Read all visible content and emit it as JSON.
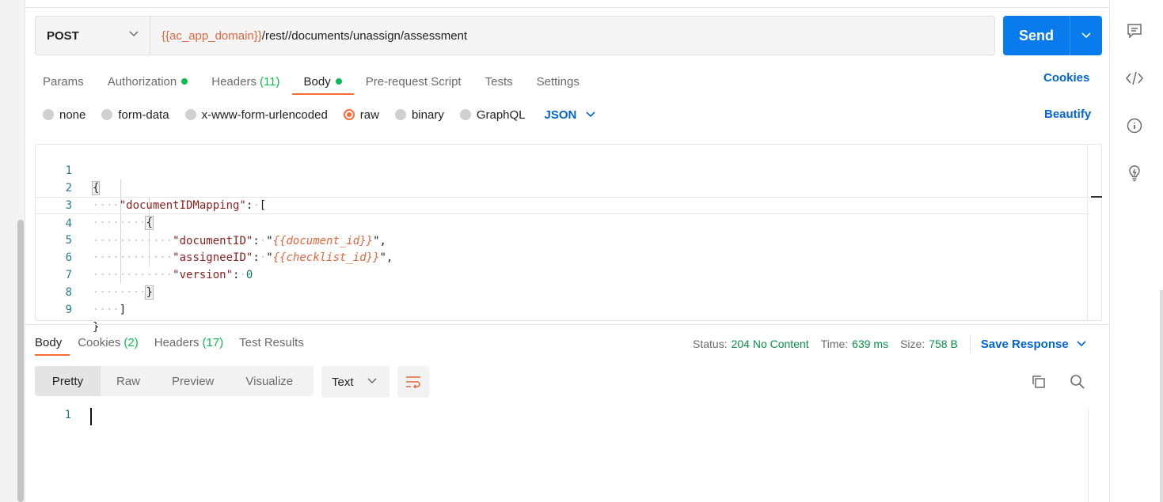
{
  "request": {
    "method": "POST",
    "url_variable": "{{ac_app_domain}}",
    "url_path": "/rest//documents/unassign/assessment",
    "send_label": "Send"
  },
  "request_tabs": [
    {
      "label": "Params",
      "count": "",
      "dot": false,
      "active": false
    },
    {
      "label": "Authorization",
      "count": "",
      "dot": true,
      "active": false
    },
    {
      "label": "Headers",
      "count": "(11)",
      "dot": false,
      "active": false
    },
    {
      "label": "Body",
      "count": "",
      "dot": true,
      "active": true
    },
    {
      "label": "Pre-request Script",
      "count": "",
      "dot": false,
      "active": false
    },
    {
      "label": "Tests",
      "count": "",
      "dot": false,
      "active": false
    },
    {
      "label": "Settings",
      "count": "",
      "dot": false,
      "active": false
    }
  ],
  "cookies_label": "Cookies",
  "body_types": [
    {
      "label": "none",
      "selected": false
    },
    {
      "label": "form-data",
      "selected": false
    },
    {
      "label": "x-www-form-urlencoded",
      "selected": false
    },
    {
      "label": "raw",
      "selected": true
    },
    {
      "label": "binary",
      "selected": false
    },
    {
      "label": "GraphQL",
      "selected": false
    }
  ],
  "body_language": "JSON",
  "beautify_label": "Beautify",
  "editor": {
    "line_numbers": [
      "1",
      "2",
      "3",
      "4",
      "5",
      "6",
      "7",
      "8",
      "9"
    ],
    "key_document_mapping": "\"documentIDMapping\"",
    "key_document_id": "\"documentID\"",
    "val_document_id": "{{document_id}}",
    "key_assignee_id": "\"assigneeID\"",
    "val_assignee_id": "{{checklist_id}}",
    "key_version": "\"version\"",
    "val_version": "0"
  },
  "response_tabs": [
    {
      "label": "Body",
      "count": "",
      "active": true
    },
    {
      "label": "Cookies",
      "count": "(2)",
      "active": false
    },
    {
      "label": "Headers",
      "count": "(17)",
      "active": false
    },
    {
      "label": "Test Results",
      "count": "",
      "active": false
    }
  ],
  "response_meta": {
    "status_label": "Status:",
    "status_value": "204 No Content",
    "time_label": "Time:",
    "time_value": "639 ms",
    "size_label": "Size:",
    "size_value": "758 B",
    "save_label": "Save Response"
  },
  "view_modes": [
    "Pretty",
    "Raw",
    "Preview",
    "Visualize"
  ],
  "response_format": "Text",
  "response_line_number": "1",
  "colors": {
    "accent_orange": "#ff6c37",
    "send_blue": "#097bed",
    "link_blue": "#0265d2",
    "success_green": "#0cbb52"
  }
}
